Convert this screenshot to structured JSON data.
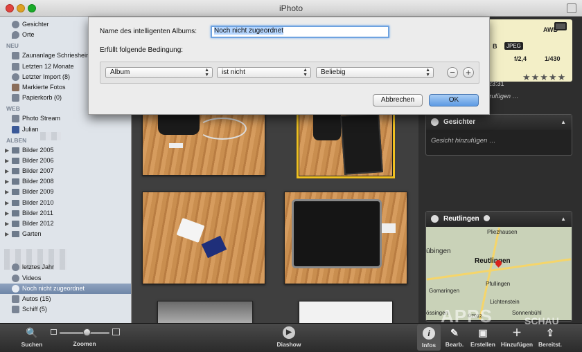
{
  "window": {
    "title": "iPhoto"
  },
  "sidebar": {
    "top_items": [
      {
        "label": "Gesichter",
        "icon": "face-icon"
      },
      {
        "label": "Orte",
        "icon": "pin-icon"
      }
    ],
    "sections": {
      "neu": "NEU",
      "web": "WEB",
      "alben": "ALBEN"
    },
    "neu_items": [
      {
        "label": "Zaunanlage Schriesheim",
        "icon": "event-icon"
      },
      {
        "label": "Letzten 12 Monate",
        "icon": "calendar-icon"
      },
      {
        "label": "Letzter Import (8)",
        "icon": "clock-icon"
      },
      {
        "label": "Markierte Fotos",
        "icon": "flag-icon"
      },
      {
        "label": "Papierkorb (0)",
        "icon": "trash-icon"
      }
    ],
    "web_items": [
      {
        "label": "Photo Stream",
        "icon": "photostream-icon"
      },
      {
        "label": "Julian",
        "icon": "facebook-icon"
      }
    ],
    "folders": [
      {
        "label": "Bilder 2005"
      },
      {
        "label": "Bilder 2006"
      },
      {
        "label": "Bilder 2007"
      },
      {
        "label": "Bilder 2008"
      },
      {
        "label": "Bilder 2009"
      },
      {
        "label": "Bilder 2010"
      },
      {
        "label": "Bilder 2011"
      },
      {
        "label": "Bilder 2012"
      },
      {
        "label": "Garten"
      }
    ],
    "albums": [
      {
        "label": "letztes Jahr",
        "icon": "smart-album-icon"
      },
      {
        "label": "Videos",
        "icon": "smart-album-icon"
      },
      {
        "label": "Noch nicht zugeordnet",
        "icon": "smart-album-icon"
      },
      {
        "label": "Autos (15)",
        "icon": "album-icon"
      },
      {
        "label": "Schiff (5)",
        "icon": "album-icon"
      }
    ]
  },
  "dialog": {
    "name_label": "Name des intelligenten Albums:",
    "name_value": "Noch nicht zugeordnet",
    "condition_label": "Erfüllt folgende Bedingung:",
    "field_select": "Album",
    "operator_select": "ist nicht",
    "value_select": "Beliebig",
    "cancel_label": "Abbrechen",
    "ok_label": "OK",
    "remove_symbol": "−",
    "add_symbol": "+"
  },
  "info_panel": {
    "awb": "AWB",
    "b": "B",
    "jpeg": "JPEG",
    "aperture": "f/2,4",
    "shutter": "1/430",
    "time": "23:31",
    "title_placeholder": "zufügen …",
    "faces_title": "Gesichter",
    "faces_placeholder": "Gesicht hinzufügen …",
    "location_title": "Reutlingen",
    "map_labels": [
      {
        "label": "Pliezhausen"
      },
      {
        "label": "übingen"
      },
      {
        "label": "Reutlingen"
      },
      {
        "label": "Pfullingen"
      },
      {
        "label": "Gomaringen"
      },
      {
        "label": "Lichtenstein"
      },
      {
        "label": "össingen"
      },
      {
        "label": "Sonnenbühl"
      }
    ],
    "map_copyright": "©2012"
  },
  "toolbar": {
    "search": "Suchen",
    "zoom": "Zoomen",
    "slideshow": "Diashow",
    "info": "Infos",
    "edit": "Bearb.",
    "create": "Erstellen",
    "add_to": "Hinzufügen",
    "share": "Bereitst."
  },
  "watermark": "APPS",
  "watermark_small": "SCHAU"
}
